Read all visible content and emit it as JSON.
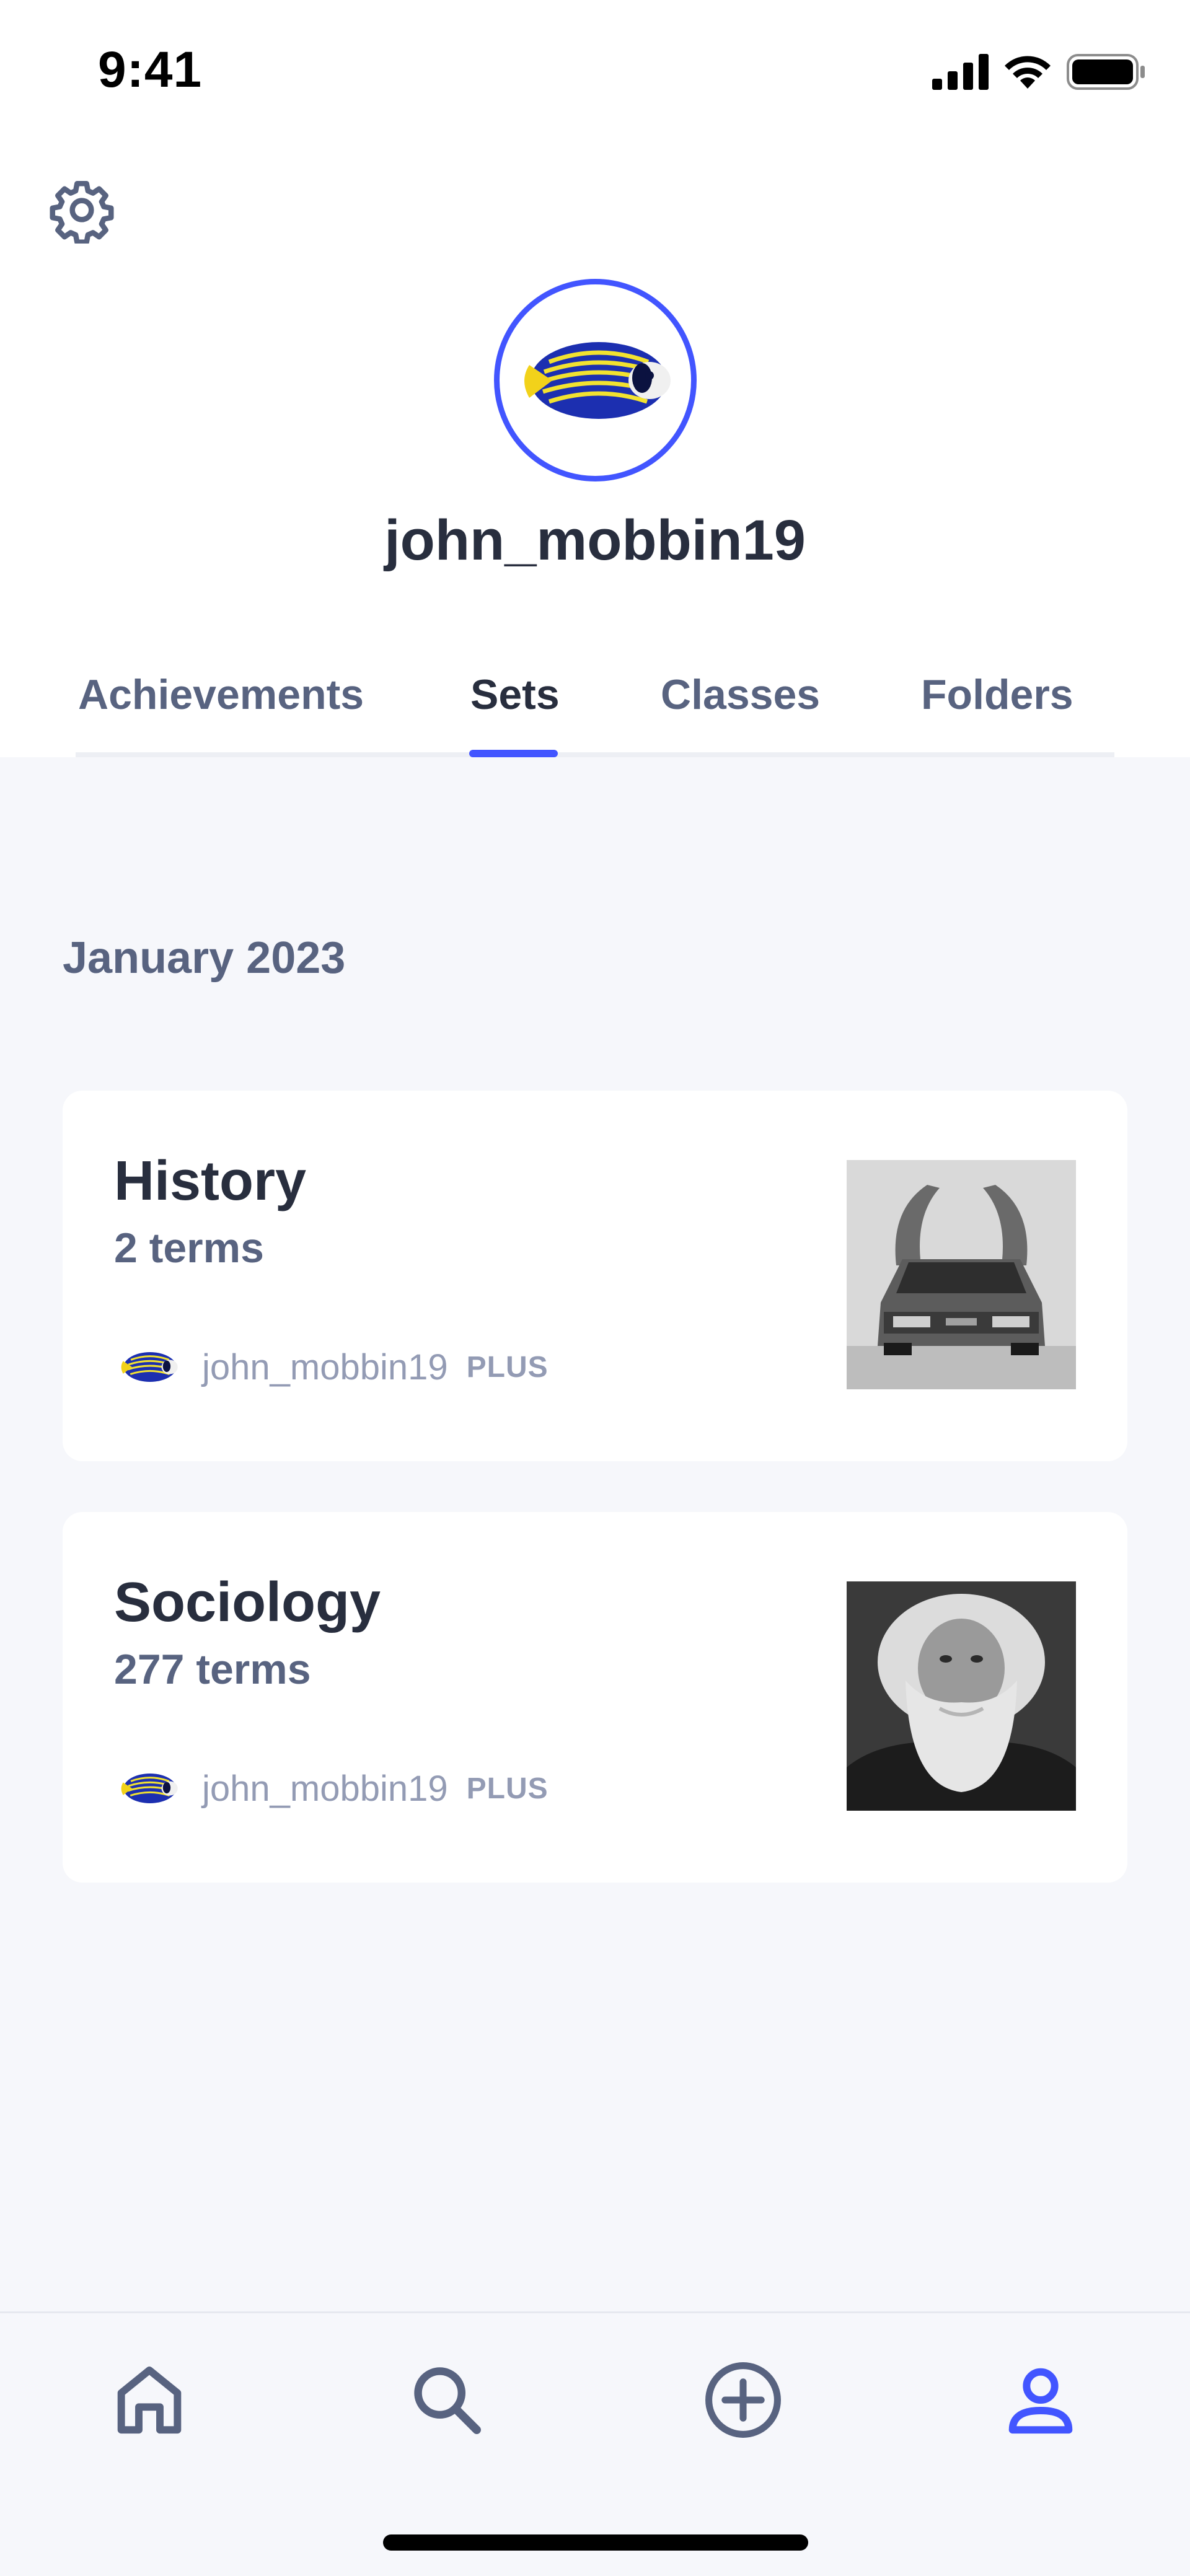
{
  "status_bar": {
    "time": "9:41"
  },
  "profile": {
    "username": "john_mobbin19",
    "avatar": "angelfish-avatar",
    "accent_color": "#4255ff"
  },
  "tabs": [
    {
      "label": "Achievements",
      "active": false
    },
    {
      "label": "Sets",
      "active": true
    },
    {
      "label": "Classes",
      "active": false
    },
    {
      "label": "Folders",
      "active": false
    }
  ],
  "section": {
    "title": "January 2023"
  },
  "sets": [
    {
      "title": "History",
      "terms": "2 terms",
      "author": "john_mobbin19",
      "badge": "PLUS",
      "thumbnail": "car-photo"
    },
    {
      "title": "Sociology",
      "terms": "277 terms",
      "author": "john_mobbin19",
      "badge": "PLUS",
      "thumbnail": "bearded-man-portrait"
    }
  ],
  "nav": {
    "items": [
      {
        "icon": "home-icon",
        "active": false
      },
      {
        "icon": "search-icon",
        "active": false
      },
      {
        "icon": "add-circle-icon",
        "active": false
      },
      {
        "icon": "profile-icon",
        "active": true
      }
    ]
  }
}
